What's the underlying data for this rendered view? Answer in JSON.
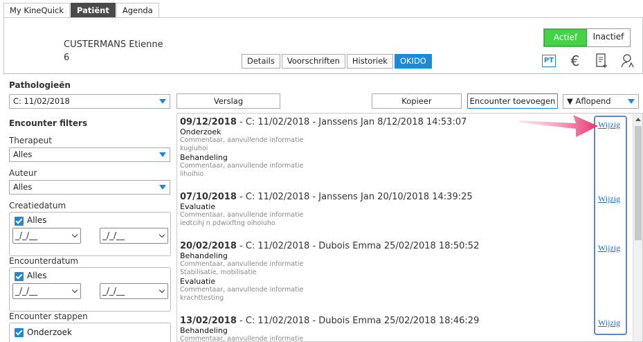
{
  "top_tabs": [
    "My KineQuick",
    "Patiënt",
    "Agenda"
  ],
  "patient": {
    "name": "CUSTERMANS Etienne",
    "number": "6"
  },
  "sub_tabs": [
    "Details",
    "Voorschriften",
    "Historiek",
    "OKIDO"
  ],
  "status": {
    "active_label": "Actief",
    "inactive_label": "Inactief"
  },
  "header_icons": {
    "pt": "PT",
    "euro": "€"
  },
  "pathology": {
    "title": "Pathologieën",
    "selected": "C: 11/02/2018"
  },
  "actions": {
    "verslag": "Verslag",
    "kopieer": "Kopieer",
    "add_encounter": "Encounter toevoegen",
    "sort": "▼ Aflopend"
  },
  "filters": {
    "title": "Encounter filters",
    "therapeut_label": "Therapeut",
    "therapeut_value": "Alles",
    "auteur_label": "Auteur",
    "auteur_value": "Alles",
    "creatiedatum_label": "Creatiedatum",
    "creatiedatum_all": "Alles",
    "encounterdatum_label": "Encounterdatum",
    "encounterdatum_all": "Alles",
    "date_placeholder": "_/_/__",
    "stappen_label": "Encounter stappen",
    "stappen_first": "Onderzoek"
  },
  "encounters": [
    {
      "date": "09/12/2018",
      "rest": " - C: 11/02/2018 - Janssens Jan 8/12/2018 14:53:07",
      "steps": [
        {
          "type": "Onderzoek",
          "comment_label": "Commentaar, aanvullende informatie",
          "comment": "kugiuhoi"
        },
        {
          "type": "Behandeling",
          "comment_label": "Commentaar, aanvullende informatie",
          "comment": "lihoihio"
        }
      ]
    },
    {
      "date": "07/10/2018",
      "rest": " - C: 11/02/2018 - Janssens Jan 20/10/2018 14:39:25",
      "steps": [
        {
          "type": "Evaluatie",
          "comment_label": "Commentaar, aanvullende informatie",
          "comment": "iedtcihj n pdwixftng oihoiuho"
        }
      ]
    },
    {
      "date": "20/02/2018",
      "rest": " - C: 11/02/2018 - Dubois Emma 25/02/2018 18:50:52",
      "steps": [
        {
          "type": "Behandeling",
          "comment_label": "Commentaar, aanvullende informatie",
          "comment": "Stabilisatie, mobilisatie"
        },
        {
          "type": "Evaluatie",
          "comment_label": "Commentaar, aanvullende informatie",
          "comment": "krachttesting"
        }
      ]
    },
    {
      "date": "13/02/2018",
      "rest": " - C: 11/02/2018 - Dubois Emma 25/02/2018 18:46:29",
      "steps": [
        {
          "type": "Behandeling",
          "comment_label": "Commentaar, aanvullende informatie",
          "comment": ""
        }
      ]
    }
  ],
  "wijzig_label": "Wijzig",
  "colors": {
    "accent": "#1e8ad6",
    "active_green": "#46d246",
    "annotation_pink": "#e8336d"
  }
}
